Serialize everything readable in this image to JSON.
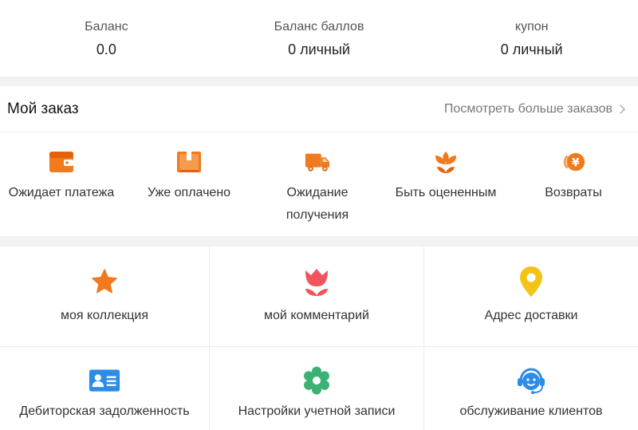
{
  "balances": [
    {
      "label": "Баланс",
      "value": "0.0"
    },
    {
      "label": "Баланс баллов",
      "value": "0 личный"
    },
    {
      "label": "купон",
      "value": "0 личный"
    }
  ],
  "orders": {
    "title": "Мой заказ",
    "more_label": "Посмотреть больше заказов",
    "statuses": [
      {
        "label": "Ожидает платежа",
        "icon": "wallet-icon"
      },
      {
        "label": "Уже оплачено",
        "icon": "package-icon"
      },
      {
        "label": "Ожидание получения",
        "icon": "truck-icon"
      },
      {
        "label": "Быть оцененным",
        "icon": "flower-icon"
      },
      {
        "label": "Возвраты",
        "icon": "yen-refund-icon"
      }
    ]
  },
  "services": [
    {
      "label": "моя коллекция",
      "icon": "star-icon"
    },
    {
      "label": "мой комментарий",
      "icon": "tulip-icon"
    },
    {
      "label": "Адрес доставки",
      "icon": "location-pin-icon"
    },
    {
      "label": "Дебиторская задолженность",
      "icon": "id-card-icon"
    },
    {
      "label": "Настройки учетной записи",
      "icon": "gear-icon"
    },
    {
      "label": "обслуживание клиентов",
      "icon": "headset-icon"
    }
  ],
  "colors": {
    "orange": "#f07a1c",
    "pink": "#f2545b",
    "yellow": "#f5c316",
    "blue": "#2c8ce6",
    "green": "#3bb273"
  }
}
